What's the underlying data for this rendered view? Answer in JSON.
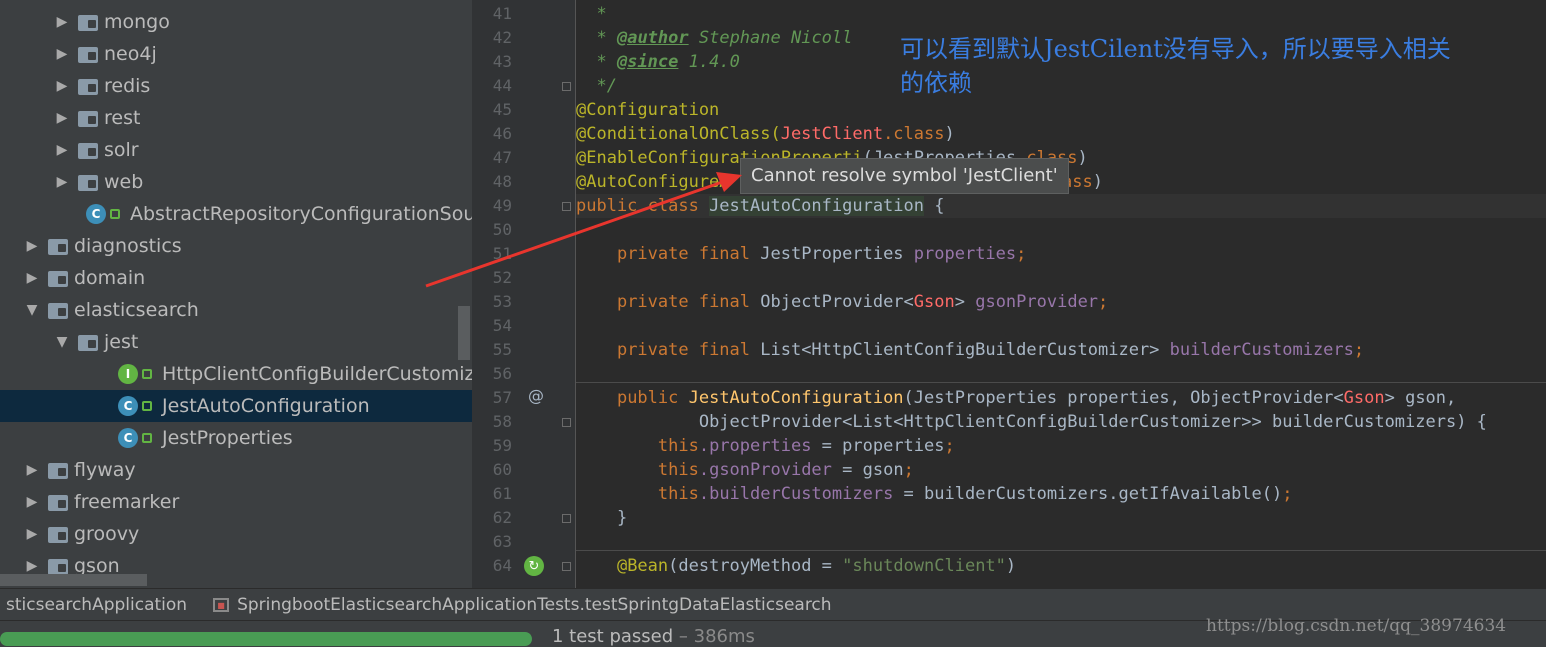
{
  "project_tree": {
    "items": [
      {
        "label": "mongo",
        "kind": "folder",
        "expanded": false
      },
      {
        "label": "neo4j",
        "kind": "folder",
        "expanded": false
      },
      {
        "label": "redis",
        "kind": "folder",
        "expanded": false
      },
      {
        "label": "rest",
        "kind": "folder",
        "expanded": false
      },
      {
        "label": "solr",
        "kind": "folder",
        "expanded": false
      },
      {
        "label": "web",
        "kind": "folder",
        "expanded": false
      },
      {
        "label": "AbstractRepositoryConfigurationSource",
        "kind": "class"
      },
      {
        "label": "diagnostics",
        "kind": "folder",
        "expanded": false
      },
      {
        "label": "domain",
        "kind": "folder",
        "expanded": false
      },
      {
        "label": "elasticsearch",
        "kind": "folder",
        "expanded": true
      },
      {
        "label": "jest",
        "kind": "folder",
        "expanded": true
      },
      {
        "label": "HttpClientConfigBuilderCustomizer",
        "kind": "interface"
      },
      {
        "label": "JestAutoConfiguration",
        "kind": "class",
        "selected": true
      },
      {
        "label": "JestProperties",
        "kind": "class"
      },
      {
        "label": "flyway",
        "kind": "folder",
        "expanded": false
      },
      {
        "label": "freemarker",
        "kind": "folder",
        "expanded": false
      },
      {
        "label": "groovy",
        "kind": "folder",
        "expanded": false
      },
      {
        "label": "gson",
        "kind": "folder",
        "expanded": false
      }
    ]
  },
  "editor": {
    "line_numbers": [
      "41",
      "42",
      "43",
      "44",
      "45",
      "46",
      "47",
      "48",
      "49",
      "50",
      "51",
      "52",
      "53",
      "54",
      "55",
      "56",
      "57",
      "58",
      "59",
      "60",
      "61",
      "62",
      "63",
      "64"
    ],
    "lines": {
      "l41": "*",
      "l42_star": "* ",
      "l42_tag": "@author",
      "l42_text": " Stephane Nicoll",
      "l43_star": "* ",
      "l43_tag": "@since",
      "l43_text": " 1.4.0",
      "l44": "*/",
      "l45": "@Configuration",
      "l46_ann": "@ConditionalOnClass(",
      "l46_err": "JestClient",
      "l46_kw": ".class",
      "l46_end": ")",
      "l47_ann": "@EnableConfigurationProperti",
      "l47_mid": "(JestProperties",
      "l47_kw": ".class",
      "l47_end": ")",
      "l48_ann": "@AutoConfigureA",
      "l48_kw": "class",
      "l48_end": ")",
      "l49_kw": "public class ",
      "l49_name": "JestAutoConfiguration",
      "l49_end": " {",
      "l51_kw": "private final ",
      "l51_type": "JestProperties ",
      "l51_fld": "properties",
      "l51_end": ";",
      "l53_kw": "private final ",
      "l53_type": "ObjectProvider<",
      "l53_err": "Gson",
      "l53_type2": "> ",
      "l53_fld": "gsonProvider",
      "l53_end": ";",
      "l55_kw": "private final ",
      "l55_type": "List<HttpClientConfigBuilderCustomizer> ",
      "l55_fld": "builderCustomizers",
      "l55_end": ";",
      "l57_kw": "public ",
      "l57_fn": "JestAutoConfiguration",
      "l57_params": "(JestProperties properties, ObjectProvider<",
      "l57_err": "Gson",
      "l57_rest": "> gson,",
      "l58": "ObjectProvider<List<HttpClientConfigBuilderCustomizer>> builderCustomizers) {",
      "l59_kw": "this",
      "l59_fld": ".properties",
      "l59_rest": " = properties",
      "l59_end": ";",
      "l60_kw": "this",
      "l60_fld": ".gsonProvider",
      "l60_rest": " = gson",
      "l60_end": ";",
      "l61_kw": "this",
      "l61_fld": ".builderCustomizers",
      "l61_rest": " = builderCustomizers.getIfAvailable()",
      "l61_end": ";",
      "l62": "}",
      "l64_ann": "@Bean",
      "l64_mid": "(destroyMethod = ",
      "l64_str": "\"shutdownClient\"",
      "l64_end": ")"
    },
    "tooltip": "Cannot resolve symbol 'JestClient'"
  },
  "annotation_note": {
    "line1": "可以看到默认JestCilent没有导入，所以要导入相关",
    "line2": "的依赖",
    "color": "#3a7de0"
  },
  "run_panel": {
    "tab1": "sticsearchApplication",
    "tab2": "SpringbootElasticsearchApplicationTests.testSprintgDataElasticsearch",
    "status": "1 test passed",
    "time": " – 386ms",
    "progress": 1.0
  },
  "watermark": "https://blog.csdn.net/qq_38974634"
}
